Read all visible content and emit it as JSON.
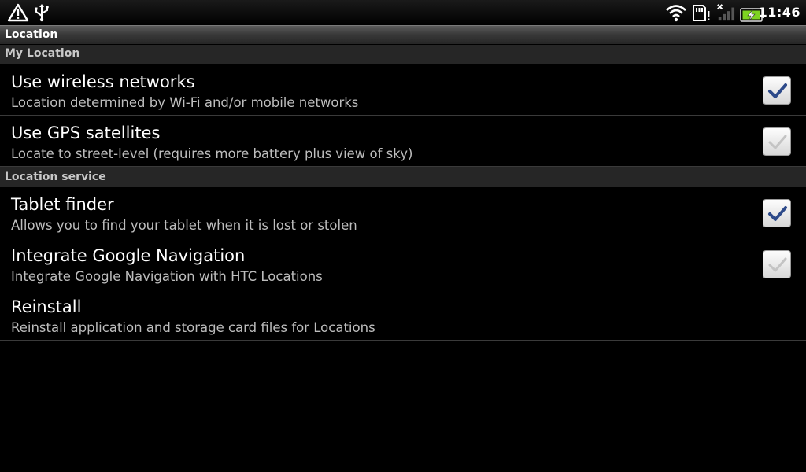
{
  "status_bar": {
    "time": "11:46",
    "icons": [
      "warning-icon",
      "usb-icon",
      "wifi-icon",
      "sd-card-icon",
      "signal-icon",
      "battery-charging-icon"
    ]
  },
  "header": {
    "title": "Location"
  },
  "sections": [
    {
      "label": "My Location"
    },
    {
      "label": "Location service"
    }
  ],
  "items": [
    {
      "title": "Use wireless networks",
      "summary": "Location determined by Wi-Fi and/or mobile networks",
      "checked": true
    },
    {
      "title": "Use GPS satellites",
      "summary": "Locate to street-level (requires more battery plus view of sky)",
      "checked": false
    },
    {
      "title": "Tablet finder",
      "summary": "Allows you to find your tablet when it is lost or stolen",
      "checked": true
    },
    {
      "title": "Integrate Google Navigation",
      "summary": "Integrate Google Navigation with HTC Locations",
      "checked": false
    },
    {
      "title": "Reinstall",
      "summary": "Reinstall application and storage card files for Locations"
    }
  ],
  "colors": {
    "check_on": "#2d4a8a",
    "check_off": "#c4c4c4",
    "battery": "#7ed321"
  }
}
